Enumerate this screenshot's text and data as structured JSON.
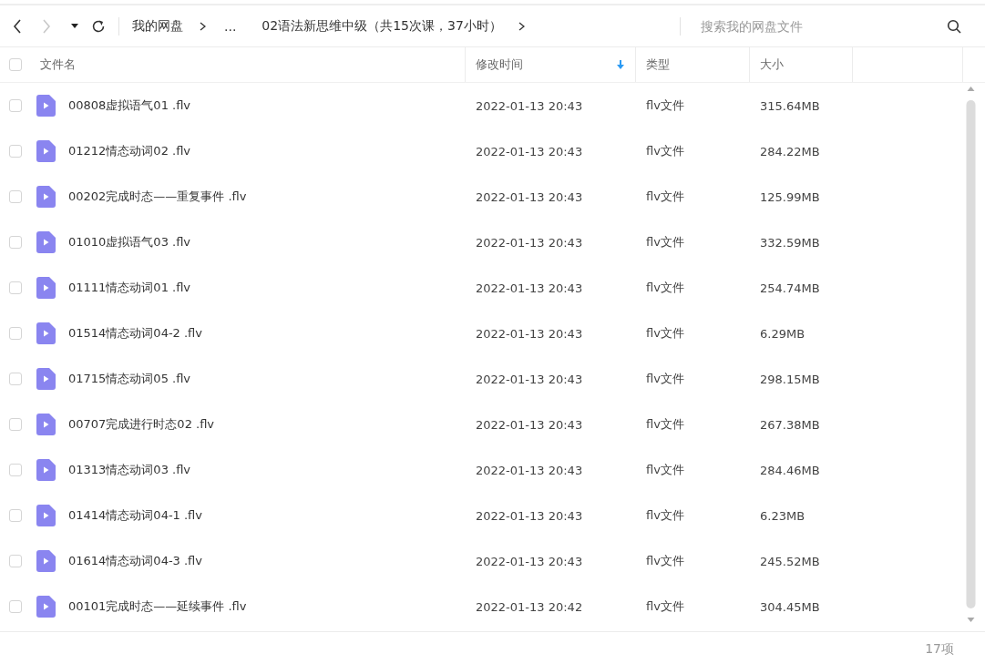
{
  "toolbar": {
    "back": {
      "disabled": false
    },
    "forward": {
      "disabled": true
    },
    "breadcrumb": [
      {
        "label": "我的网盘",
        "separator": true
      },
      {
        "label": "...",
        "separator": false
      },
      {
        "label": "02语法新思维中级（共15次课，37小时）",
        "separator": true
      }
    ],
    "search": {
      "placeholder": "搜索我的网盘文件"
    }
  },
  "table": {
    "select_all": {
      "checked": false
    },
    "columns": [
      {
        "label": "文件名",
        "sorted": false
      },
      {
        "label": "修改时间",
        "sorted": true
      },
      {
        "label": "类型",
        "sorted": false
      },
      {
        "label": "大小",
        "sorted": false
      }
    ],
    "rows": [
      {
        "checked": false,
        "name": "00808虚拟语气01 .flv",
        "modified": "2022-01-13 20:43",
        "type": "flv文件",
        "size": "315.64MB"
      },
      {
        "checked": false,
        "name": "01212情态动词02 .flv",
        "modified": "2022-01-13 20:43",
        "type": "flv文件",
        "size": "284.22MB"
      },
      {
        "checked": false,
        "name": "00202完成时态——重复事件 .flv",
        "modified": "2022-01-13 20:43",
        "type": "flv文件",
        "size": "125.99MB"
      },
      {
        "checked": false,
        "name": "01010虚拟语气03 .flv",
        "modified": "2022-01-13 20:43",
        "type": "flv文件",
        "size": "332.59MB"
      },
      {
        "checked": false,
        "name": "01111情态动词01 .flv",
        "modified": "2022-01-13 20:43",
        "type": "flv文件",
        "size": "254.74MB"
      },
      {
        "checked": false,
        "name": "01514情态动词04-2 .flv",
        "modified": "2022-01-13 20:43",
        "type": "flv文件",
        "size": "6.29MB"
      },
      {
        "checked": false,
        "name": "01715情态动词05 .flv",
        "modified": "2022-01-13 20:43",
        "type": "flv文件",
        "size": "298.15MB"
      },
      {
        "checked": false,
        "name": "00707完成进行时态02 .flv",
        "modified": "2022-01-13 20:43",
        "type": "flv文件",
        "size": "267.38MB"
      },
      {
        "checked": false,
        "name": "01313情态动词03 .flv",
        "modified": "2022-01-13 20:43",
        "type": "flv文件",
        "size": "284.46MB"
      },
      {
        "checked": false,
        "name": "01414情态动词04-1 .flv",
        "modified": "2022-01-13 20:43",
        "type": "flv文件",
        "size": "6.23MB"
      },
      {
        "checked": false,
        "name": "01614情态动词04-3 .flv",
        "modified": "2022-01-13 20:43",
        "type": "flv文件",
        "size": "245.52MB"
      },
      {
        "checked": false,
        "name": "00101完成时态——延续事件 .flv",
        "modified": "2022-01-13 20:42",
        "type": "flv文件",
        "size": "304.45MB"
      }
    ]
  },
  "status_bar": {
    "count": "17项"
  }
}
